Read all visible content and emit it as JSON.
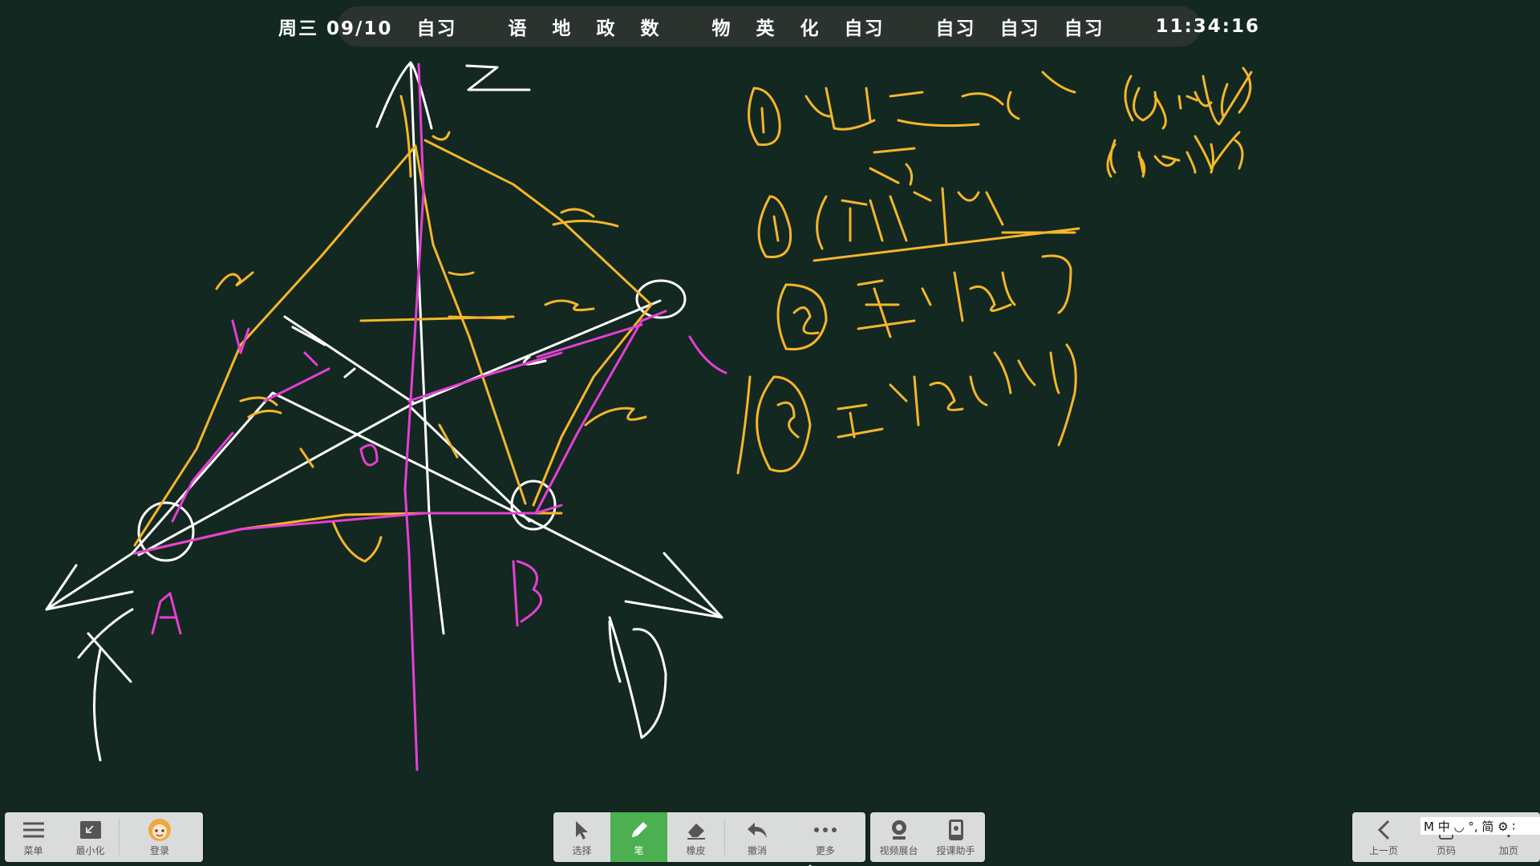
{
  "schedule": {
    "date": "周三 09/10",
    "first": "自习",
    "group1": [
      "语",
      "地",
      "政",
      "数"
    ],
    "group2": [
      "物",
      "英",
      "化",
      "自习"
    ],
    "group3": [
      "自习",
      "自习",
      "自习"
    ],
    "time": "11:34:16"
  },
  "left_toolbar": [
    {
      "label": "菜单",
      "icon": "menu-icon"
    },
    {
      "label": "最小化",
      "icon": "minimize-icon"
    },
    {
      "label": "登录",
      "icon": "avatar-icon"
    }
  ],
  "center_toolbar": [
    {
      "label": "选择",
      "icon": "cursor-icon"
    },
    {
      "label": "笔",
      "icon": "pen-icon",
      "active": true
    },
    {
      "label": "橡皮",
      "icon": "eraser-icon"
    },
    {
      "label": "撤消",
      "icon": "undo-icon"
    },
    {
      "label": "更多",
      "icon": "more-icon"
    }
  ],
  "assist_toolbar": [
    {
      "label": "视频展台",
      "icon": "camera-icon"
    },
    {
      "label": "授课助手",
      "icon": "assistant-icon"
    }
  ],
  "right_toolbar": [
    {
      "label": "上一页",
      "icon": "chevron-left-icon"
    },
    {
      "label": "页码",
      "icon": "page-icon"
    },
    {
      "label": "加页",
      "icon": "add-page-icon"
    }
  ],
  "ime_bar": "M 中 ◡ °, 简 ⚙ ∶",
  "colors": {
    "board": "#132820",
    "ink_white": "#ffffff",
    "ink_yellow": "#f5b62a",
    "ink_magenta": "#e63fd6",
    "active_tool": "#4caf50"
  }
}
